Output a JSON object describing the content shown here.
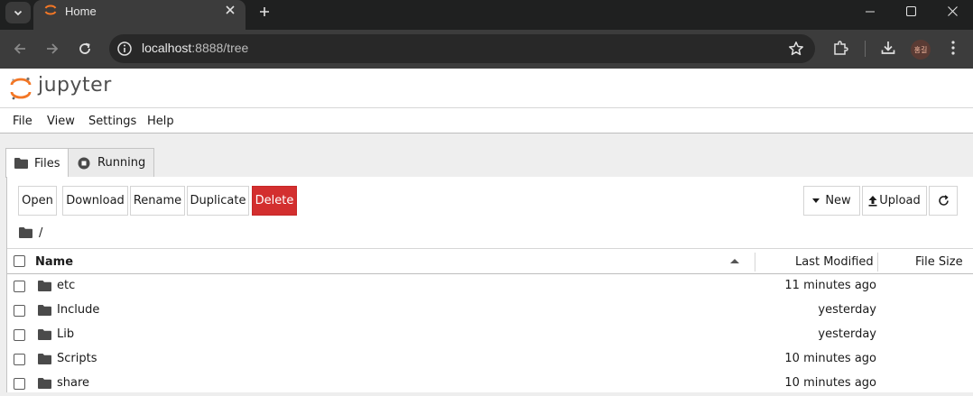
{
  "browser": {
    "tab_title": "Home",
    "url_host": "localhost",
    "url_rest": ":8888/tree",
    "avatar_text": "홍길",
    "colors": {
      "jupyter_orange": "#F37726",
      "delete_red": "#D32F2F"
    }
  },
  "app": {
    "logo_text": "jupyter"
  },
  "menu": {
    "items": [
      "File",
      "View",
      "Settings",
      "Help"
    ]
  },
  "tabs": [
    {
      "label": "Files",
      "icon": "folder-icon",
      "active": true
    },
    {
      "label": "Running",
      "icon": "stop-circle-icon",
      "active": false
    }
  ],
  "toolbar": {
    "open": "Open",
    "download": "Download",
    "rename": "Rename",
    "duplicate": "Duplicate",
    "delete": "Delete",
    "new": "New",
    "upload": "Upload"
  },
  "breadcrumb": {
    "path": "/"
  },
  "list": {
    "headers": {
      "name": "Name",
      "modified": "Last Modified",
      "size": "File Size"
    },
    "rows": [
      {
        "name": "etc",
        "modified": "11 minutes ago"
      },
      {
        "name": "Include",
        "modified": "yesterday"
      },
      {
        "name": "Lib",
        "modified": "yesterday"
      },
      {
        "name": "Scripts",
        "modified": "10 minutes ago"
      },
      {
        "name": "share",
        "modified": "10 minutes ago"
      }
    ]
  }
}
